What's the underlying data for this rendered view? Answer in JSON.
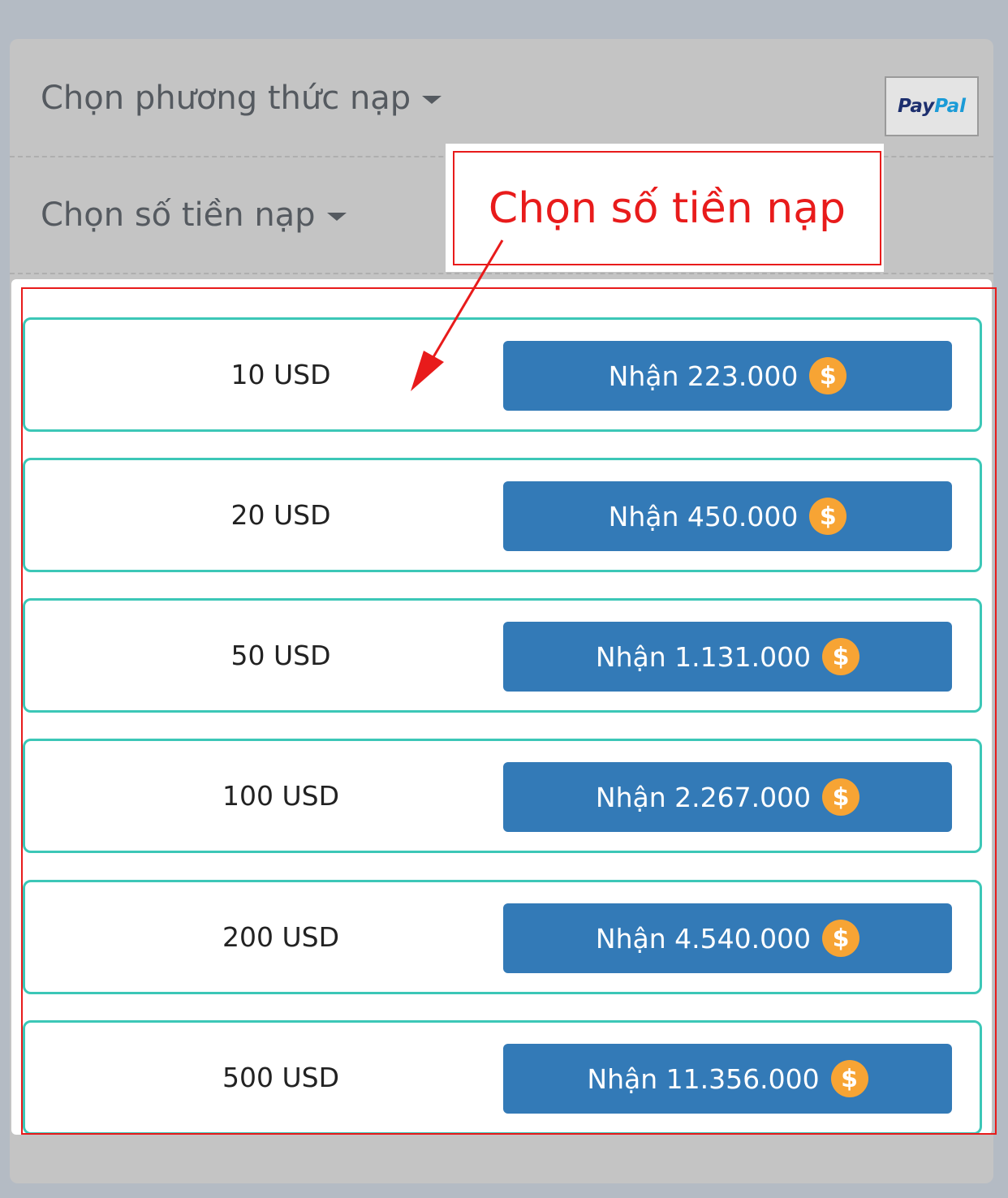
{
  "header": {
    "method_label": "Chọn phương thức nạp",
    "amount_label": "Chọn số tiền nạp",
    "paypal": {
      "part1": "Pay",
      "part2": "Pal"
    }
  },
  "callout": {
    "text": "Chọn số tiền nạp"
  },
  "packages": [
    {
      "usd": "10 USD",
      "receive": "Nhận 223.000"
    },
    {
      "usd": "20 USD",
      "receive": "Nhận 450.000"
    },
    {
      "usd": "50 USD",
      "receive": "Nhận 1.131.000"
    },
    {
      "usd": "100 USD",
      "receive": "Nhận 2.267.000"
    },
    {
      "usd": "200 USD",
      "receive": "Nhận 4.540.000"
    },
    {
      "usd": "500 USD",
      "receive": "Nhận 11.356.000"
    }
  ],
  "coin_symbol": "$",
  "colors": {
    "button": "#337ab7",
    "package_border": "#3cc7b7",
    "coin": "#f7a434",
    "annotation": "#e81b1b"
  }
}
